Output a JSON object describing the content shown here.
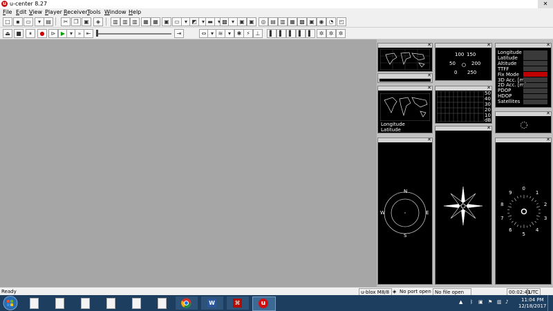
{
  "window": {
    "title": "u-center 8.27",
    "logo_text": "u",
    "close_glyph": "✕"
  },
  "menu": [
    "File",
    "Edit",
    "View",
    "Player",
    "Receiver",
    "Tools",
    "Window",
    "Help"
  ],
  "panes": {
    "sky": {
      "longitude": "Longitude",
      "latitude": "Latitude"
    },
    "deviation": {
      "labels": [
        "100",
        "150",
        "50",
        "200",
        "0",
        "250"
      ]
    },
    "signal": {
      "axis": [
        "50",
        "40",
        "30",
        "20",
        "10",
        "dB"
      ]
    },
    "data": {
      "rows": [
        "Longitude",
        "Latitude",
        "Altitude",
        "TTFF",
        "Fix Mode",
        "3D Acc. [m]",
        "2D Acc. [m]",
        "PDOP",
        "HDOP",
        "Satellites"
      ]
    },
    "compass": {
      "n": "N",
      "s": "S",
      "e": "E",
      "w": "W"
    },
    "clock": {
      "numbers": [
        "0",
        "1",
        "2",
        "3",
        "4",
        "5",
        "6",
        "7",
        "8",
        "9"
      ]
    }
  },
  "status": {
    "ready": "Ready",
    "receiver": "u-blox M8/8",
    "port": "No port open",
    "file": "No file open",
    "time": "00:02:41",
    "tz": "UTC"
  },
  "taskbar": {
    "time": "11:04 PM",
    "date": "12/18/2017"
  },
  "colors": {
    "workspace": "#a6a6a6",
    "taskbar": "#1e3e5f",
    "fixmode": "#c00000"
  }
}
